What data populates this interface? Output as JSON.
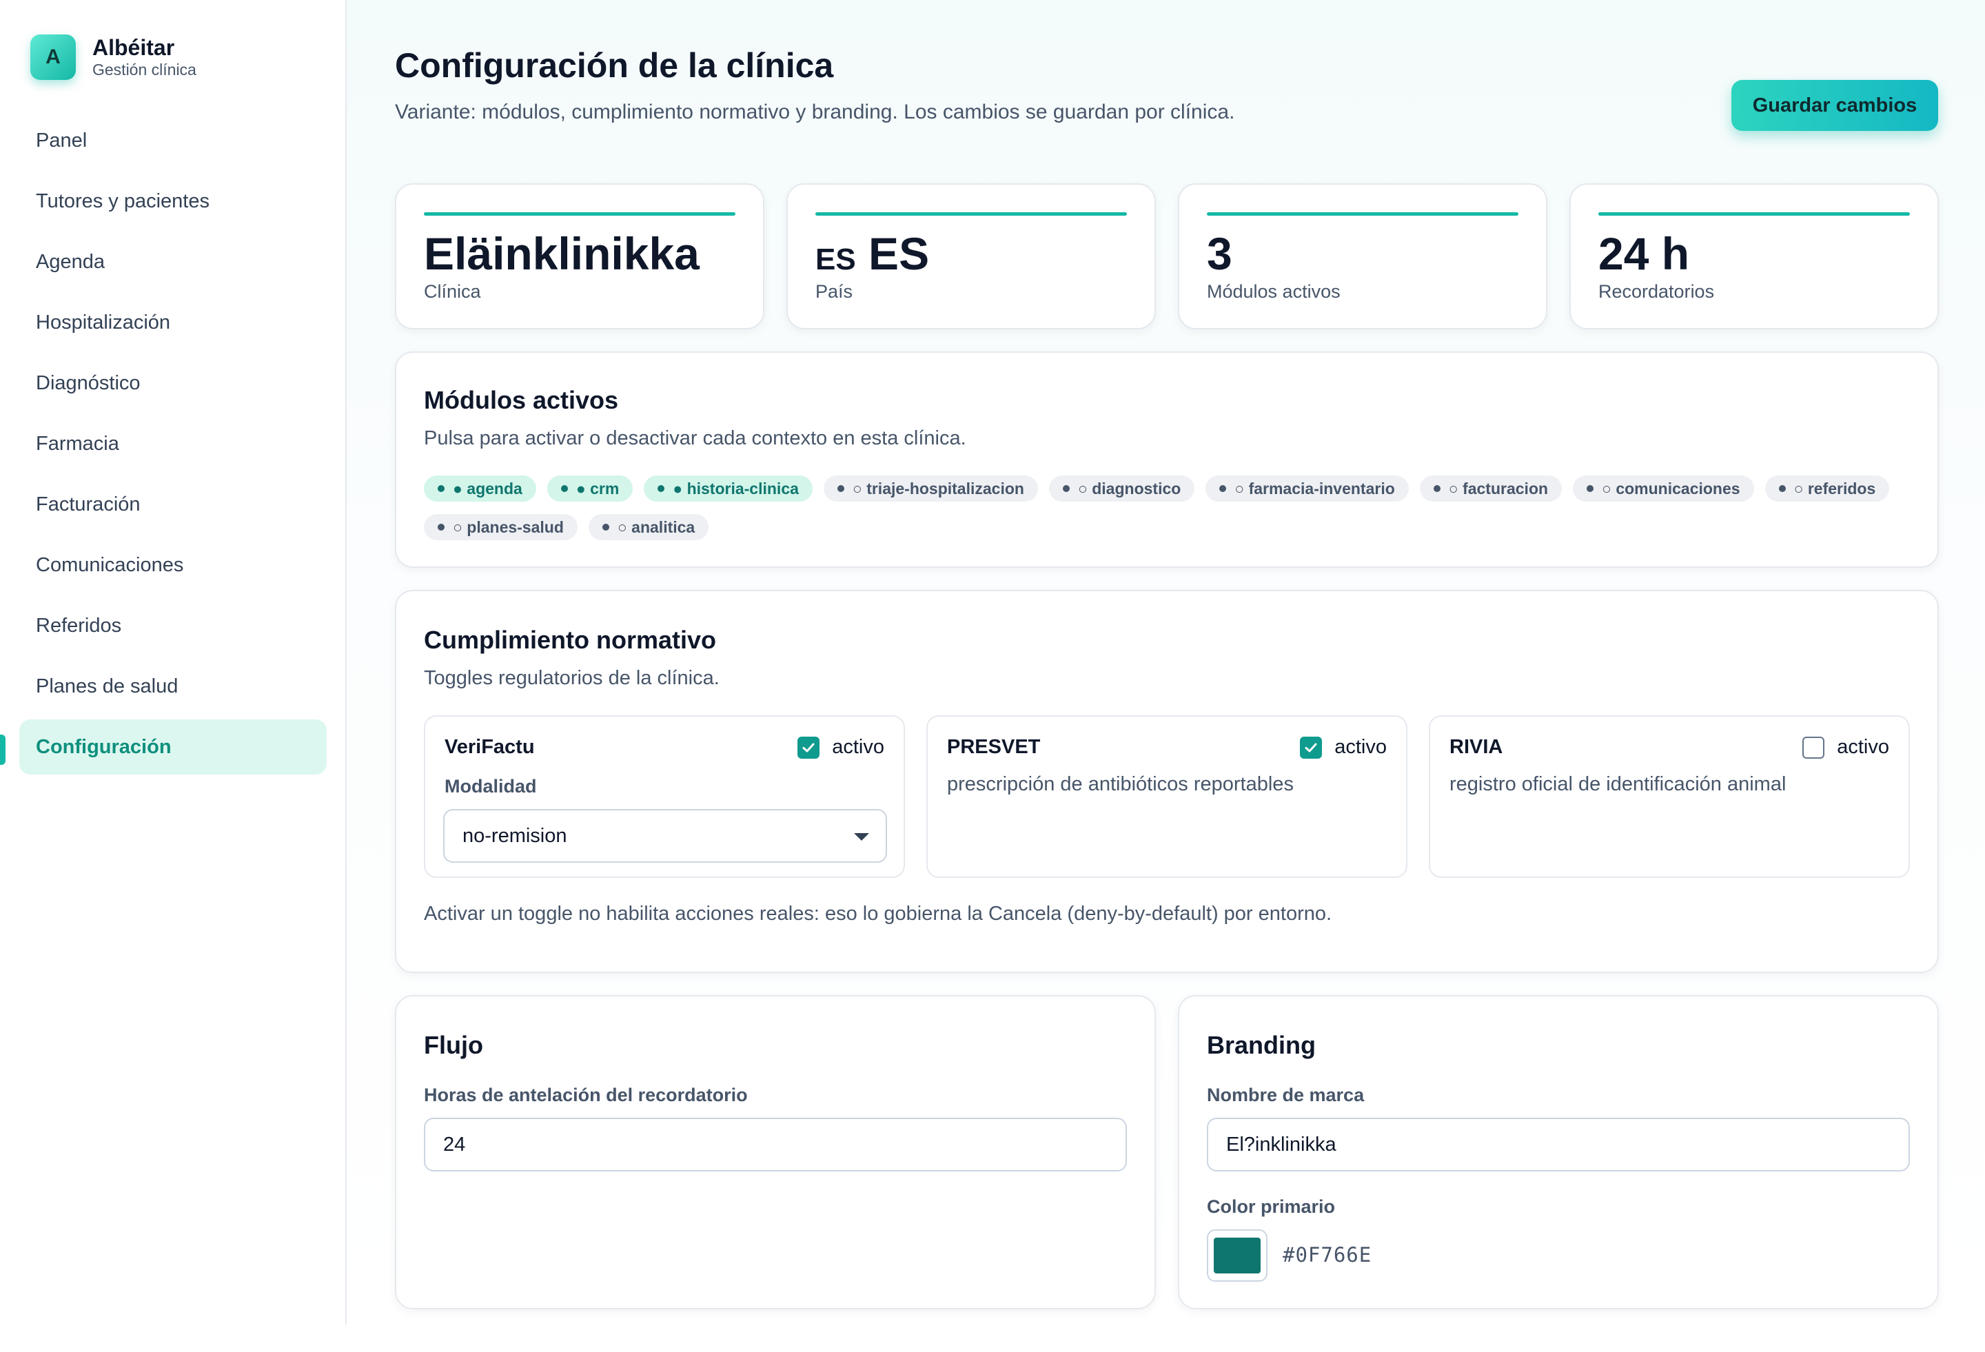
{
  "brand": {
    "logo_letter": "A",
    "name": "Albéitar",
    "subtitle": "Gestión clínica"
  },
  "nav": {
    "items": [
      {
        "label": "Panel"
      },
      {
        "label": "Tutores y pacientes"
      },
      {
        "label": "Agenda"
      },
      {
        "label": "Hospitalización"
      },
      {
        "label": "Diagnóstico"
      },
      {
        "label": "Farmacia"
      },
      {
        "label": "Facturación"
      },
      {
        "label": "Comunicaciones"
      },
      {
        "label": "Referidos"
      },
      {
        "label": "Planes de salud"
      },
      {
        "label": "Configuración",
        "active": true
      }
    ]
  },
  "header": {
    "title": "Configuración de la clínica",
    "subtitle": "Variante: módulos, cumplimiento normativo y branding. Los cambios se guardan por clínica.",
    "save_label": "Guardar cambios"
  },
  "stats": [
    {
      "value": "Eläinklinikka",
      "label": "Clínica"
    },
    {
      "value_prefix": "ES",
      "value": "ES",
      "label": "País"
    },
    {
      "value": "3",
      "label": "Módulos activos"
    },
    {
      "value": "24 h",
      "label": "Recordatorios"
    }
  ],
  "modules": {
    "title": "Módulos activos",
    "description": "Pulsa para activar o desactivar cada contexto en esta clínica.",
    "chips": [
      {
        "label": "● agenda",
        "active": true
      },
      {
        "label": "● crm",
        "active": true
      },
      {
        "label": "● historia-clinica",
        "active": true
      },
      {
        "label": "○ triaje-hospitalizacion",
        "active": false
      },
      {
        "label": "○ diagnostico",
        "active": false
      },
      {
        "label": "○ farmacia-inventario",
        "active": false
      },
      {
        "label": "○ facturacion",
        "active": false
      },
      {
        "label": "○ comunicaciones",
        "active": false
      },
      {
        "label": "○ referidos",
        "active": false
      },
      {
        "label": "○ planes-salud",
        "active": false
      },
      {
        "label": "○ analitica",
        "active": false
      }
    ]
  },
  "compliance": {
    "title": "Cumplimiento normativo",
    "description": "Toggles regulatorios de la clínica.",
    "items": [
      {
        "name": "VeriFactu",
        "checked": true,
        "check_label": "activo",
        "field_label": "Modalidad",
        "select_value": "no-remision"
      },
      {
        "name": "PRESVET",
        "checked": true,
        "check_label": "activo",
        "description": "prescripción de antibióticos reportables"
      },
      {
        "name": "RIVIA",
        "checked": false,
        "check_label": "activo",
        "description": "registro oficial de identificación animal"
      }
    ],
    "note": "Activar un toggle no habilita acciones reales: eso lo gobierna la Cancela (deny-by-default) por entorno."
  },
  "flow": {
    "title": "Flujo",
    "reminder_label": "Horas de antelación del recordatorio",
    "reminder_value": "24"
  },
  "branding": {
    "title": "Branding",
    "brand_name_label": "Nombre de marca",
    "brand_name_value": "El?inklinikka",
    "color_label": "Color primario",
    "color_value": "#0F766E"
  },
  "colors": {
    "accent": "#14B8A6",
    "primary": "#0F766E",
    "active_nav_bg": "#DCF7EF"
  }
}
